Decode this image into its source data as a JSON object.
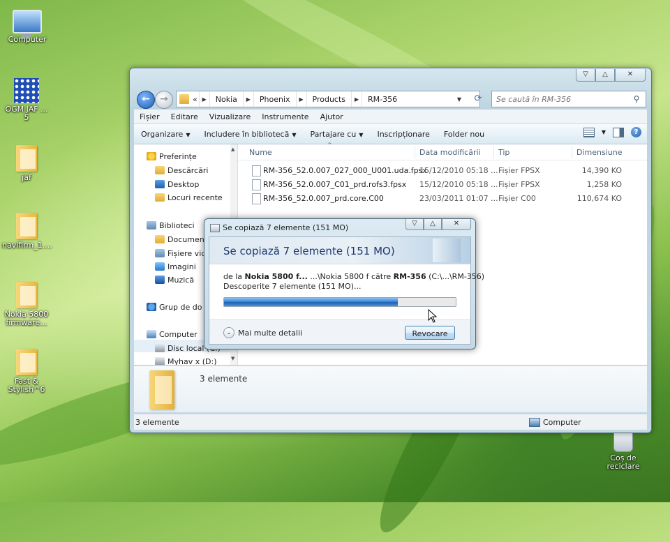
{
  "desktop": {
    "icons": [
      {
        "label": "Computer"
      },
      {
        "label": "OGM JAF ...\n5"
      },
      {
        "label": "jaf"
      },
      {
        "label": "navifirm_1...."
      },
      {
        "label": "Nokia 5800\nfirmware..."
      },
      {
        "label": "Fast &\nStylish^6"
      },
      {
        "label": "Coș de\nreciclare"
      }
    ]
  },
  "explorer": {
    "window_buttons": {
      "minimize": "▽",
      "maximize": "△",
      "close": "✕"
    },
    "breadcrumb": [
      "«",
      "Nokia",
      "Phoenix",
      "Products",
      "RM-356"
    ],
    "search_placeholder": "Se caută în RM-356",
    "menu": [
      "Fișier",
      "Editare",
      "Vizualizare",
      "Instrumente",
      "Ajutor"
    ],
    "commands": [
      "Organizare",
      "Includere în bibliotecă",
      "Partajare cu",
      "Inscripționare",
      "Folder nou"
    ],
    "nav": {
      "favorites": "Preferințe",
      "downloads": "Descărcări",
      "desktop": "Desktop",
      "recent": "Locuri recente",
      "libraries": "Biblioteci",
      "documents": "Document",
      "videos": "Fișiere vide",
      "pictures": "Imagini",
      "music": "Muzică",
      "homegroup": "Grup de do",
      "computer": "Computer",
      "localdisk": "Disc local (C:)",
      "drive_d": "Myhav x (D:)"
    },
    "columns": [
      "Nume",
      "Data modificării",
      "Tip",
      "Dimensiune"
    ],
    "files": [
      {
        "name": "RM-356_52.0.007_027_000_U001.uda.fpsx",
        "date": "15/12/2010 05:18 ...",
        "type": "Fișier FPSX",
        "size": "14,390 KO"
      },
      {
        "name": "RM-356_52.0.007_C01_prd.rofs3.fpsx",
        "date": "15/12/2010 05:18 ...",
        "type": "Fișier FPSX",
        "size": "1,258 KO"
      },
      {
        "name": "RM-356_52.0.007_prd.core.C00",
        "date": "23/03/2011 01:07 ...",
        "type": "Fișier C00",
        "size": "110,674 KO"
      }
    ],
    "details": "3 elemente",
    "status_count": "3 elemente",
    "status_location": "Computer"
  },
  "copy_dialog": {
    "title": "Se copiază 7 elemente (151 MO)",
    "heading": "Se copiază 7 elemente (151 MO)",
    "from_prefix": "de la ",
    "from_name": "Nokia 5800 f...",
    "from_path": " ...\\Nokia 5800 f  către ",
    "to_name": "RM-356",
    "to_path": " (C:\\...\\RM-356)",
    "found": "Descoperite 7 elemente (151 MO)...",
    "progress": 0.75,
    "more_details": "Mai multe detalii",
    "cancel": "Revocare"
  }
}
